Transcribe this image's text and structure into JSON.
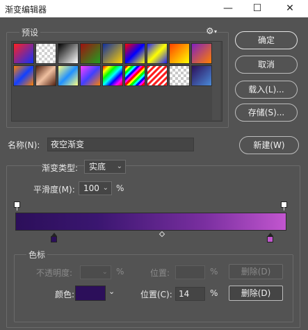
{
  "window": {
    "title": "渐变编辑器",
    "minimize_glyph": "—",
    "maximize_glyph": "☐",
    "close_glyph": "✕"
  },
  "presets": {
    "title": "预设",
    "gear_glyph": "⚙",
    "menu_caret": "▾",
    "swatches": [
      {
        "bg": "linear-gradient(135deg,#ff2020 0%,#1030ff 100%)"
      },
      {
        "bg": "repeating-conic-gradient(#ffffff 0 25%, #d0d0d0 0 50%) 0 0/8px 8px, linear-gradient(135deg,#ff2020,#ff2020)",
        "checker": true
      },
      {
        "bg": "linear-gradient(135deg,#000000 0%,#ffffff 100%)"
      },
      {
        "bg": "linear-gradient(135deg,#a01010 0%,#20a020 100%)"
      },
      {
        "bg": "linear-gradient(135deg,#1030a0 0%,#ffd000 100%)"
      },
      {
        "bg": "linear-gradient(135deg,#ff0000 0%,#0000ff 50%,#ffff00 100%)"
      },
      {
        "bg": "linear-gradient(135deg,#2020ff 0%,#ffff00 50%,#2020ff 100%)"
      },
      {
        "bg": "linear-gradient(135deg,#ff4000 0%,#ffff00 100%)"
      },
      {
        "bg": "linear-gradient(135deg,#8020c0 0%,#ff8000 100%)"
      },
      {
        "bg": "linear-gradient(135deg,#ff8000 0%,#1040ff 50%,#ff8000 100%)"
      },
      {
        "bg": "linear-gradient(135deg,#502010 0%,#f0c0a0 50%,#502010 100%)"
      },
      {
        "bg": "linear-gradient(135deg,#ffff80 0%,#2090ff 50%,#ffff80 100%)"
      },
      {
        "bg": "linear-gradient(135deg,#ff40ff 0%,#4040ff 50%,#ff8000 100%)"
      },
      {
        "bg": "linear-gradient(135deg,#ff0000,#ffff00,#00ff00,#00ffff,#0000ff,#ff00ff,#ff0000)"
      },
      {
        "bg": "repeating-linear-gradient(135deg,#ff0000 0 3px,#ffff00 3px 6px,#00ff00 6px 9px,#00ffff 9px 12px,#0000ff 12px 15px,#ff00ff 15px 18px)"
      },
      {
        "bg": "repeating-linear-gradient(135deg,#ff2020 0 3px,#ffffff 3px 6px)"
      },
      {
        "bg": "repeating-conic-gradient(#ffffff 0 25%, #c8c8c8 0 50%) 0 0/8px 8px",
        "checker": true
      },
      {
        "bg": "linear-gradient(135deg,#2c0f5a 0%,#4a8ad8 100%)"
      }
    ]
  },
  "buttons": {
    "ok": "确定",
    "cancel": "取消",
    "load": "载入(L)...",
    "save": "存储(S)...",
    "new": "新建(W)"
  },
  "name": {
    "label": "名称(N):",
    "value": "夜空渐变"
  },
  "gradient": {
    "type_label": "渐变类型:",
    "type_value": "实底",
    "smoothness_label": "平滑度(M):",
    "smoothness_value": "100",
    "smoothness_unit": "%",
    "bar_start_color": "#2c0f5a",
    "bar_end_color": "#c256cf"
  },
  "stops": {
    "title": "色标",
    "opacity_label": "不透明度:",
    "opacity_value": "",
    "opacity_unit": "%",
    "opacity_position_label": "位置:",
    "opacity_position_value": "",
    "opacity_position_unit": "%",
    "opacity_delete": "删除(D)",
    "color_label": "颜色:",
    "color_value": "#2c0f5a",
    "color_position_label": "位置(C):",
    "color_position_value": "14",
    "color_position_unit": "%",
    "color_delete": "删除(D)",
    "selected_stop_color": "#2c0f5a",
    "end_stop_color": "#c256cf"
  }
}
